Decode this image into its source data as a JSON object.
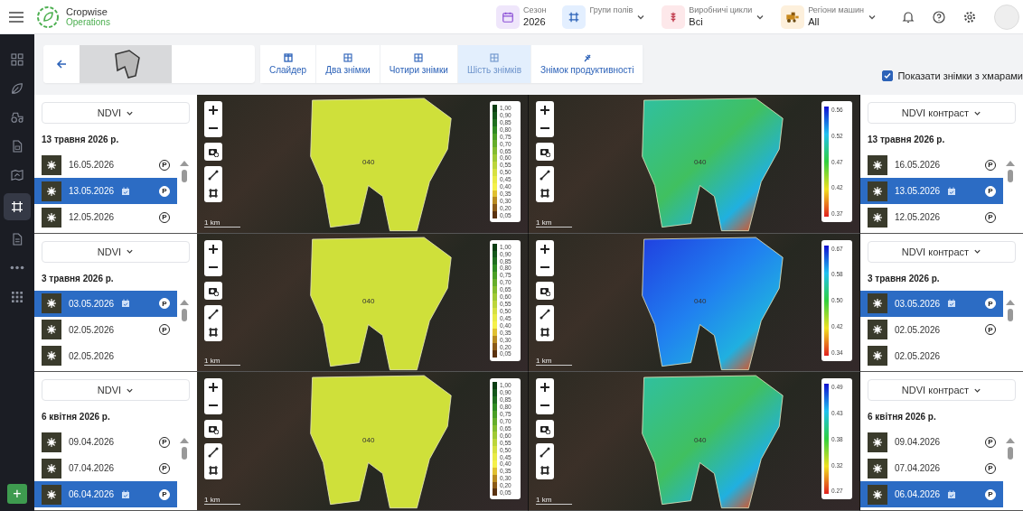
{
  "top_bar": {
    "brand": "Cropwise",
    "product": "Operations",
    "filters": [
      {
        "kind": "season",
        "label": "Сезон",
        "value": "2026"
      },
      {
        "kind": "groups",
        "label": "Групи полів"
      },
      {
        "kind": "cycles",
        "label": "Виробничі цикли",
        "value": "Всі"
      },
      {
        "kind": "regions",
        "label": "Регіони машин",
        "value": "All"
      }
    ]
  },
  "sidebar": {
    "items": [
      {
        "kind": "dashboard",
        "selected": false
      },
      {
        "kind": "leaf",
        "selected": false
      },
      {
        "kind": "tractor",
        "selected": false
      },
      {
        "kind": "document",
        "selected": false
      },
      {
        "kind": "map",
        "selected": false
      },
      {
        "kind": "frame",
        "selected": true
      },
      {
        "kind": "report",
        "selected": false
      },
      {
        "kind": "more",
        "selected": false
      },
      {
        "kind": "apps",
        "selected": false
      }
    ],
    "add_button": "+"
  },
  "view_tabs": [
    {
      "kind": "slider",
      "label": "Слайдер",
      "selected": false
    },
    {
      "kind": "two",
      "label": "Два знімки",
      "selected": false
    },
    {
      "kind": "four",
      "label": "Чотири знімки",
      "selected": false
    },
    {
      "kind": "six",
      "label": "Шість знімків",
      "selected": true
    },
    {
      "kind": "yield",
      "label": "Знімок продуктивності",
      "selected": false
    }
  ],
  "show_cloudy": {
    "label": "Показати знімки з хмарами",
    "checked": true
  },
  "rows": [
    {
      "left_panel": {
        "index": "NDVI",
        "date_heading": "13 травня 2026 р.",
        "images": [
          {
            "date": "16.05.2026",
            "badge": "P",
            "selected": false
          },
          {
            "date": "13.05.2026",
            "badge": "P",
            "selected": true
          },
          {
            "date": "12.05.2026",
            "badge": "P",
            "selected": false
          }
        ]
      },
      "maps": [
        {
          "kind": "ndvi",
          "field_label": "040",
          "scale": "1 km",
          "legend": [
            "1,00",
            "0,90",
            "0,85",
            "0,80",
            "0,75",
            "0,70",
            "0,65",
            "0,60",
            "0,55",
            "0,50",
            "0,45",
            "0,40",
            "0,35",
            "0,30",
            "0,20",
            "0,05"
          ]
        },
        {
          "kind": "contrast",
          "field_label": "040",
          "scale": "1 km",
          "legend": [
            "0.56",
            "0.52",
            "0.47",
            "0.42",
            "0.37"
          ]
        }
      ],
      "right_panel": {
        "index": "NDVI контраст",
        "date_heading": "13 травня 2026 р.",
        "images": [
          {
            "date": "16.05.2026",
            "badge": "P",
            "selected": false
          },
          {
            "date": "13.05.2026",
            "badge": "P",
            "selected": true
          },
          {
            "date": "12.05.2026",
            "badge": "P",
            "selected": false
          }
        ]
      }
    },
    {
      "left_panel": {
        "index": "NDVI",
        "date_heading": "3 травня 2026 р.",
        "images": [
          {
            "date": "03.05.2026",
            "badge": "P",
            "selected": true
          },
          {
            "date": "02.05.2026",
            "badge": "P",
            "selected": false
          },
          {
            "date": "02.05.2026",
            "selected": false
          }
        ]
      },
      "maps": [
        {
          "kind": "ndvi",
          "field_label": "040",
          "scale": "1 km",
          "legend": [
            "1,00",
            "0,90",
            "0,85",
            "0,80",
            "0,75",
            "0,70",
            "0,65",
            "0,60",
            "0,55",
            "0,50",
            "0,45",
            "0,40",
            "0,35",
            "0,30",
            "0,20",
            "0,05"
          ]
        },
        {
          "kind": "contrast",
          "field_label": "040",
          "scale": "1 km",
          "legend": [
            "0.67",
            "0.58",
            "0.50",
            "0.42",
            "0.34"
          ]
        }
      ],
      "right_panel": {
        "index": "NDVI контраст",
        "date_heading": "3 травня 2026 р.",
        "images": [
          {
            "date": "03.05.2026",
            "badge": "P",
            "selected": true
          },
          {
            "date": "02.05.2026",
            "badge": "P",
            "selected": false
          },
          {
            "date": "02.05.2026",
            "selected": false
          }
        ]
      }
    },
    {
      "left_panel": {
        "index": "NDVI",
        "date_heading": "6 квітня 2026 р.",
        "images": [
          {
            "date": "09.04.2026",
            "badge": "P",
            "selected": false
          },
          {
            "date": "07.04.2026",
            "badge": "P",
            "selected": false
          },
          {
            "date": "06.04.2026",
            "badge": "P",
            "selected": true
          }
        ]
      },
      "maps": [
        {
          "kind": "ndvi",
          "field_label": "040",
          "scale": "1 km",
          "legend": [
            "1,00",
            "0,90",
            "0,85",
            "0,80",
            "0,75",
            "0,70",
            "0,65",
            "0,60",
            "0,55",
            "0,50",
            "0,45",
            "0,40",
            "0,35",
            "0,30",
            "0,20",
            "0,05"
          ]
        },
        {
          "kind": "contrast",
          "field_label": "040",
          "scale": "1 km",
          "legend": [
            "0.49",
            "0.43",
            "0.38",
            "0.32",
            "0.27"
          ]
        }
      ],
      "right_panel": {
        "index": "NDVI контраст",
        "date_heading": "6 квітня 2026 р.",
        "images": [
          {
            "date": "09.04.2026",
            "badge": "P",
            "selected": false
          },
          {
            "date": "07.04.2026",
            "badge": "P",
            "selected": false
          },
          {
            "date": "06.04.2026",
            "badge": "P",
            "selected": true
          }
        ]
      }
    }
  ]
}
